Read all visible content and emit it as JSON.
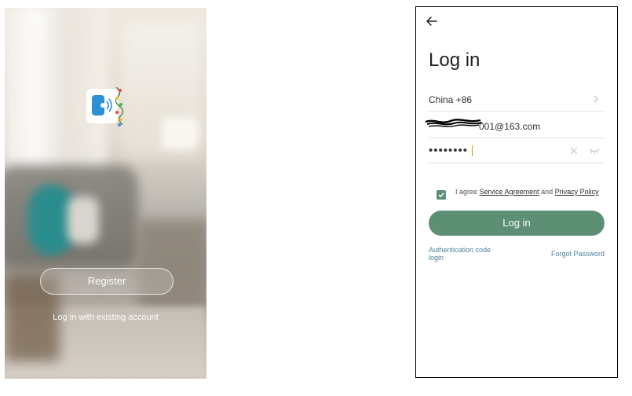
{
  "welcome": {
    "register_label": "Register",
    "existing_account_label": "Log in with existing account"
  },
  "login": {
    "title": "Log in",
    "country": "China +86",
    "email_visible_suffix": "@163.com",
    "email_visible_digits": "001",
    "password_masked": "••••••••",
    "agree_prefix": "I agree",
    "service_agreement": "Service Agreement",
    "agree_and": "and",
    "privacy_policy": "Privacy Policy",
    "login_label": "Log in",
    "auth_code_label": "Authentication code login",
    "forgot_label": "Forgot Password",
    "checkbox_checked": true
  },
  "colors": {
    "accent": "#5d8f74",
    "link": "#4a7f99"
  },
  "icons": {
    "back": "back-arrow-icon",
    "chevron": "chevron-right-icon",
    "clear": "clear-icon",
    "eye": "eye-hidden-icon",
    "checkbox": "checkbox-checked-icon",
    "logo": "app-logo-icon"
  }
}
